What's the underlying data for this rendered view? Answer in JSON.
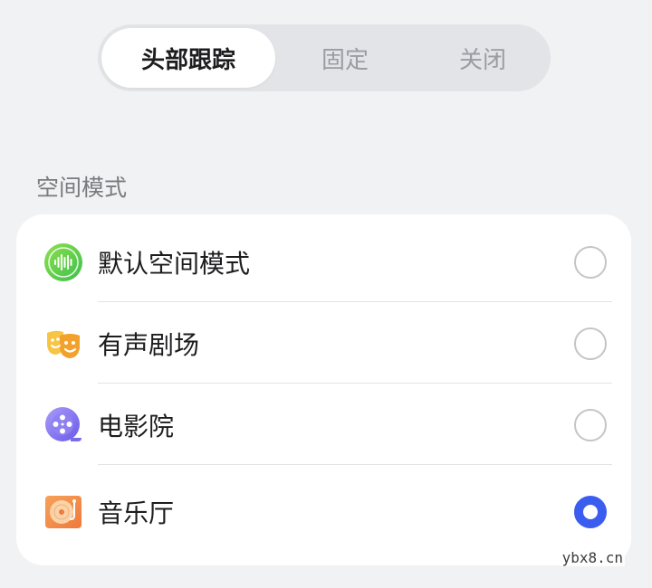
{
  "tracking": {
    "options": [
      "头部跟踪",
      "固定",
      "关闭"
    ],
    "selected": "头部跟踪"
  },
  "spatial": {
    "section_title": "空间模式",
    "items": [
      {
        "label": "默认空间模式",
        "icon": "sound-wave-icon",
        "checked": false
      },
      {
        "label": "有声剧场",
        "icon": "theater-masks-icon",
        "checked": false
      },
      {
        "label": "电影院",
        "icon": "film-reel-icon",
        "checked": false
      },
      {
        "label": "音乐厅",
        "icon": "vinyl-record-icon",
        "checked": true
      }
    ]
  },
  "colors": {
    "accent": "#3a5df0",
    "background": "#f1f2f4",
    "segment_bg": "#e3e4e7"
  },
  "watermark": "ybx8.cn"
}
